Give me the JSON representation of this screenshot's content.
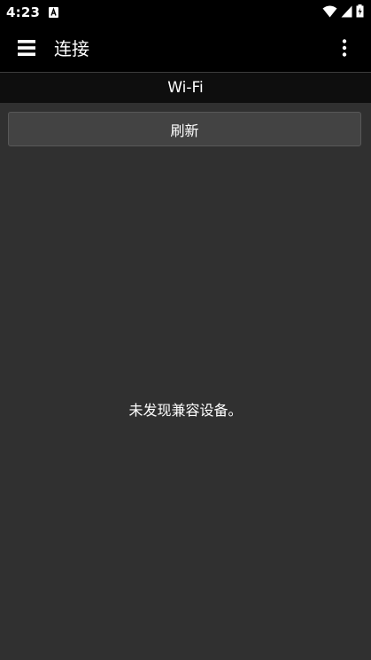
{
  "status_bar": {
    "time": "4:23",
    "notification_icon": "app-notification-icon",
    "wifi_icon": "wifi-icon",
    "signal_icon": "cell-signal-icon",
    "battery_icon": "battery-charging-icon"
  },
  "app_bar": {
    "menu_icon": "hamburger-menu-icon",
    "title": "连接",
    "overflow_icon": "more-vert-icon"
  },
  "section": {
    "title": "Wi-Fi"
  },
  "main": {
    "refresh_label": "刷新",
    "empty_message": "未发现兼容设备。"
  },
  "colors": {
    "background": "#303030",
    "app_bar": "#000000",
    "section_header": "#0e0e0e",
    "button": "#434343",
    "text": "#ffffff"
  }
}
